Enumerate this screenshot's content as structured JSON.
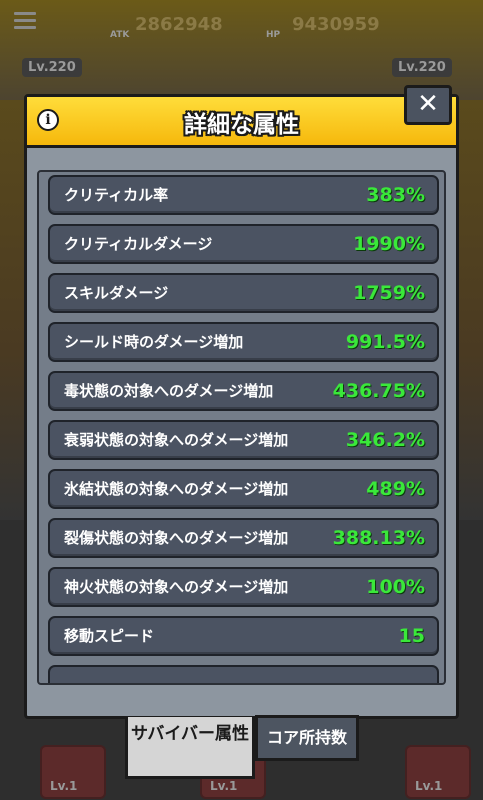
{
  "background": {
    "atk_value": "2862948",
    "atk_label": "ATK",
    "hp_value": "9430959",
    "hp_label": "HP",
    "left_level": "Lv.220",
    "right_level": "Lv.220",
    "card_levels": [
      "Lv.1",
      "Lv.1",
      "Lv.1"
    ]
  },
  "modal": {
    "title": "詳細な属性",
    "info_icon": "i",
    "close_icon": "✕",
    "attributes": [
      {
        "label": "クリティカル率",
        "value": "383%"
      },
      {
        "label": "クリティカルダメージ",
        "value": "1990%"
      },
      {
        "label": "スキルダメージ",
        "value": "1759%"
      },
      {
        "label": "シールド時のダメージ増加",
        "value": "991.5%"
      },
      {
        "label": "毒状態の対象へのダメージ増加",
        "value": "436.75%"
      },
      {
        "label": "衰弱状態の対象へのダメージ増加",
        "value": "346.2%"
      },
      {
        "label": "氷結状態の対象へのダメージ増加",
        "value": "489%"
      },
      {
        "label": "裂傷状態の対象へのダメージ増加",
        "value": "388.13%"
      },
      {
        "label": "神火状態の対象へのダメージ増加",
        "value": "100%"
      },
      {
        "label": "移動スピード",
        "value": "15"
      }
    ]
  },
  "tabs": {
    "survivor_attr": "サバイバー属性",
    "core_owned": "コア所持数"
  },
  "colors": {
    "header_yellow": "#ffcc1a",
    "value_green": "#3ae83a",
    "row_bg": "#4b5362",
    "panel_bg": "#8d96a0"
  }
}
